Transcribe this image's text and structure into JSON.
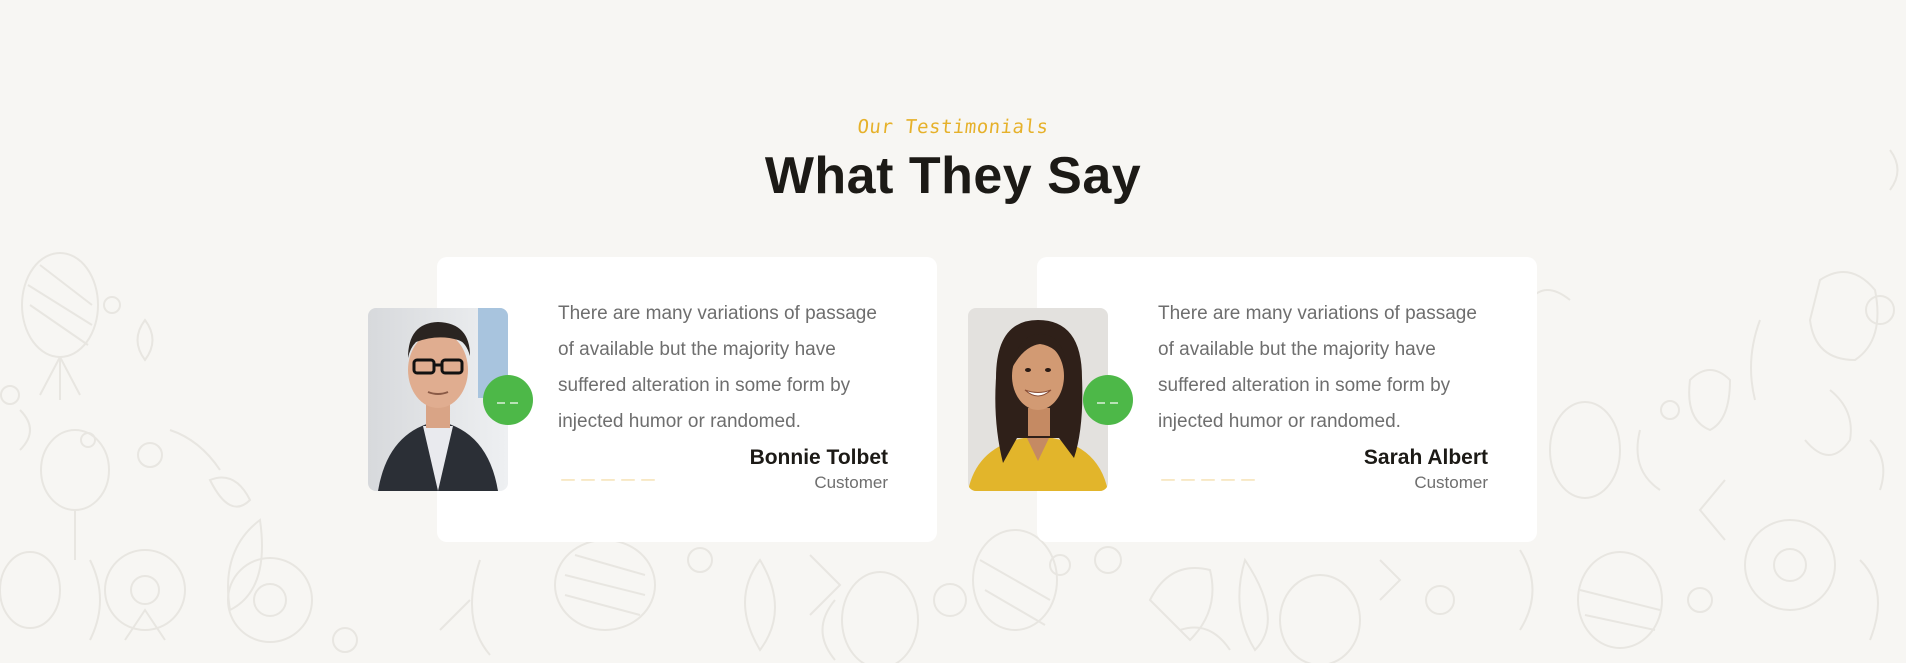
{
  "section": {
    "tagline": "Our Testimonials",
    "heading": "What They Say"
  },
  "testimonials": [
    {
      "quote": "There are many variations of passage of available but the majority have suffered alteration in some form by injected humor or randomed.",
      "name": "Bonnie Tolbet",
      "role": "Customer",
      "rating": 5,
      "photo_icon": "man-portrait"
    },
    {
      "quote": "There are many variations of passage of available but the majority have suffered alteration in some form by injected humor or randomed.",
      "name": "Sarah Albert",
      "role": "Customer",
      "rating": 5,
      "photo_icon": "woman-portrait"
    }
  ],
  "colors": {
    "accent_yellow": "#e6b12a",
    "quote_green": "#4db848",
    "heading": "#1c1a16",
    "body_text": "#6e6e6e",
    "background": "#f7f6f3",
    "star": "#f2d79a"
  },
  "icons": {
    "quote": "quote-icon",
    "star": "star-icon",
    "background": "vegetable-doodle-pattern"
  }
}
